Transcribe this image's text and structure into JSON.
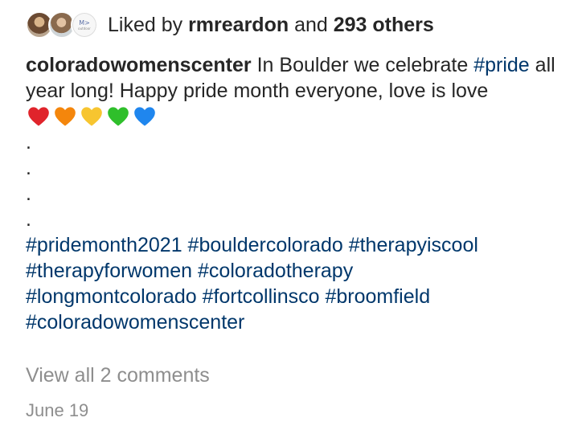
{
  "likes": {
    "prefix": "Liked by",
    "user": "rmreardon",
    "conjunction": "and",
    "others": "293 others",
    "avatars": [
      "avatar-photo",
      "avatar-photo",
      "brand-logo"
    ],
    "logo_text": "M>",
    "logo_subtext": "outdoor"
  },
  "caption": {
    "username": "coloradowomenscenter",
    "text_before_tag": "In Boulder we celebrate",
    "tag_pride": "#pride",
    "text_after_tag": "all year long! Happy pride month everyone, love is love",
    "hearts": [
      {
        "name": "red-heart-icon",
        "color": "#e0242b"
      },
      {
        "name": "orange-heart-icon",
        "color": "#f4860c"
      },
      {
        "name": "yellow-heart-icon",
        "color": "#f7c530"
      },
      {
        "name": "green-heart-icon",
        "color": "#2fbf2b"
      },
      {
        "name": "blue-heart-icon",
        "color": "#1f86ee"
      }
    ],
    "dots": [
      ".",
      ".",
      ".",
      "."
    ],
    "hashtags": [
      "#pridemonth2021",
      "#bouldercolorado",
      "#therapyiscool",
      "#therapyforwomen",
      "#coloradotherapy",
      "#longmontcolorado",
      "#fortcollinsco",
      "#broomfield",
      "#coloradowomenscenter"
    ]
  },
  "comments": {
    "view_all": "View all 2 comments"
  },
  "date": "June 19",
  "colors": {
    "text": "#262626",
    "hashtag": "#00376b",
    "muted": "#8e8e8e"
  }
}
